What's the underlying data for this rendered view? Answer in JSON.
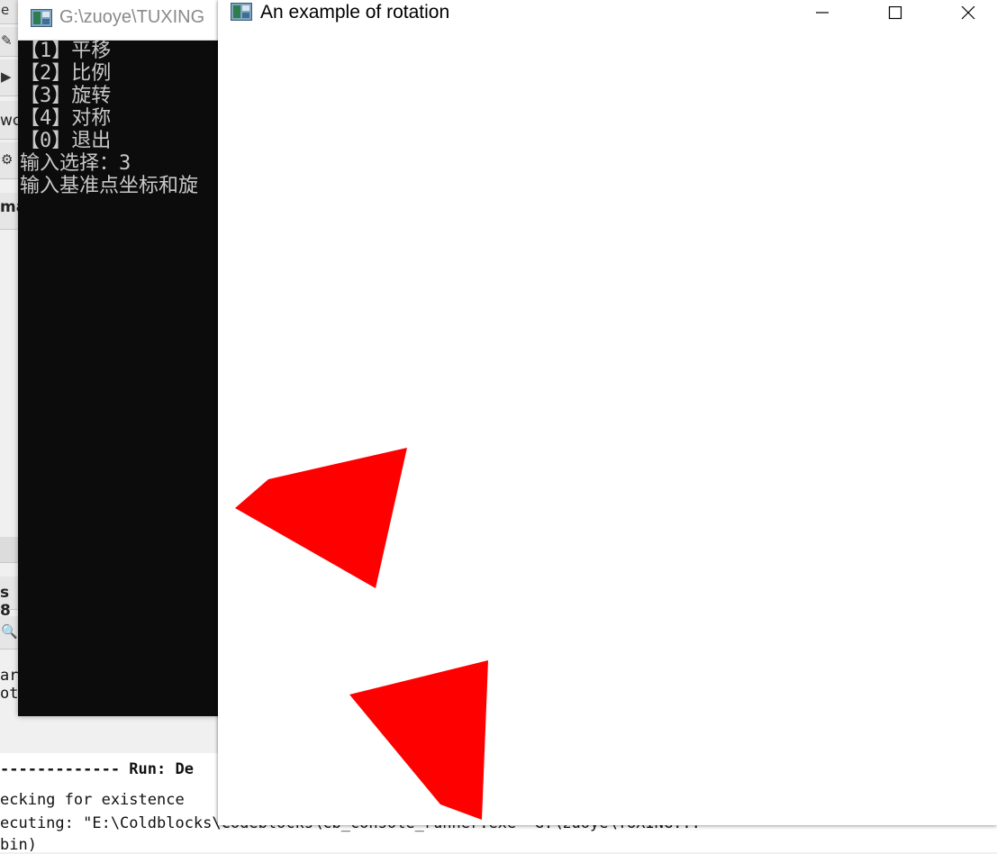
{
  "console_window": {
    "title": "G:\\zuoye\\TUXING",
    "lines": [
      "【1】平移",
      "【2】比例",
      "【3】旋转",
      "【4】对称",
      "【0】退出",
      "输入选择：3",
      "输入基准点坐标和旋"
    ]
  },
  "graphics_window": {
    "title": "An example of rotation",
    "fill_color": "#ff0000",
    "controls": [
      "minimize",
      "maximize",
      "close"
    ]
  },
  "ide_background": {
    "left_fragments": [
      "e",
      "wcl",
      "ma",
      "s 8",
      "arg",
      "oth"
    ],
    "log_lines": [
      "------------- Run: De",
      "ecking for existence",
      "ecuting: \"E:\\Coldblocks\\Codeblocks\\cb_console_runner.exe\" G:\\zuoye\\TUXING...",
      "bin)"
    ]
  }
}
